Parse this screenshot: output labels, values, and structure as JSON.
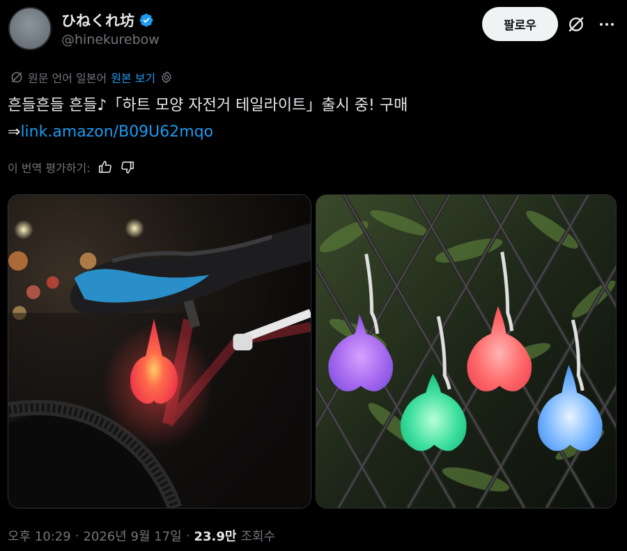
{
  "author": {
    "display_name": "ひねくれ坊",
    "handle": "@hinekurebow",
    "verified_icon": "verified-badge-icon",
    "avatar_color": "#7a828a"
  },
  "header": {
    "follow_label": "팔로우",
    "grok_icon": "grok-icon",
    "more_icon": "more-options-icon"
  },
  "translation": {
    "source_label": "원문 언어 일본어",
    "show_original_label": "원본 보기",
    "settings_icon": "gear-icon"
  },
  "tweet": {
    "text_line1": "흔들흔들 흔들♪「하트 모양 자전거 테일라이트」출시 중! 구매",
    "arrow": "⇒",
    "link_text": "link.amazon/B09U62mqo"
  },
  "rating": {
    "label": "이 번역 평가하기:",
    "thumbs_up_icon": "thumbs-up-icon",
    "thumbs_down_icon": "thumbs-down-icon"
  },
  "media": {
    "left_alt": "bike-saddle-heart-taillight-photo",
    "right_alt": "heart-lights-on-fence-photo"
  },
  "meta": {
    "time": "오후 10:29",
    "separator": "·",
    "date": "2026년 9월 17일",
    "views_count": "23.9만",
    "views_label": "조회수"
  },
  "colors": {
    "accent": "#1d9bf0",
    "background": "#000000",
    "text_primary": "#e7e9ea",
    "text_secondary": "#71767b"
  }
}
